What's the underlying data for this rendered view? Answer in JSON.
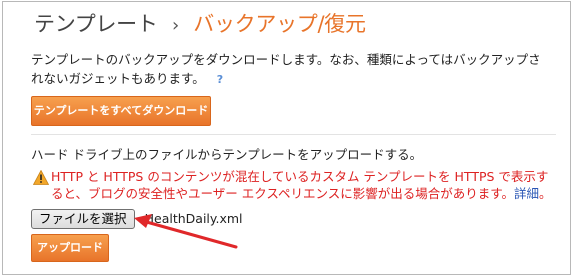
{
  "header": {
    "breadcrumb_parent": "テンプレート",
    "separator": "›",
    "current": "バックアップ/復元"
  },
  "backup": {
    "description": "テンプレートのバックアップをダウンロードします。なお、種類によってはバックアップされないガジェットもあります。",
    "help_label": "?",
    "download_button": "テンプレートをすべてダウンロード"
  },
  "restore": {
    "label": "ハード ドライブ上のファイルからテンプレートをアップロードする。",
    "warning_text": "HTTP と HTTPS のコンテンツが混在しているカスタム テンプレートを HTTPS で表示すると、ブログの安全性やユーザー エクスペリエンスに影響が出る場合があります。",
    "warning_link": "詳細",
    "warning_tail": "。",
    "file_button": "ファイルを選択",
    "file_name": "HealthDaily.xml",
    "upload_button": "アップロード"
  },
  "colors": {
    "accent": "#e8742a",
    "warning": "#dd2222",
    "link": "#2a56b5",
    "annotation_arrow": "#e0282a"
  },
  "icons": {
    "help": "help-icon",
    "warning": "warning-icon"
  }
}
